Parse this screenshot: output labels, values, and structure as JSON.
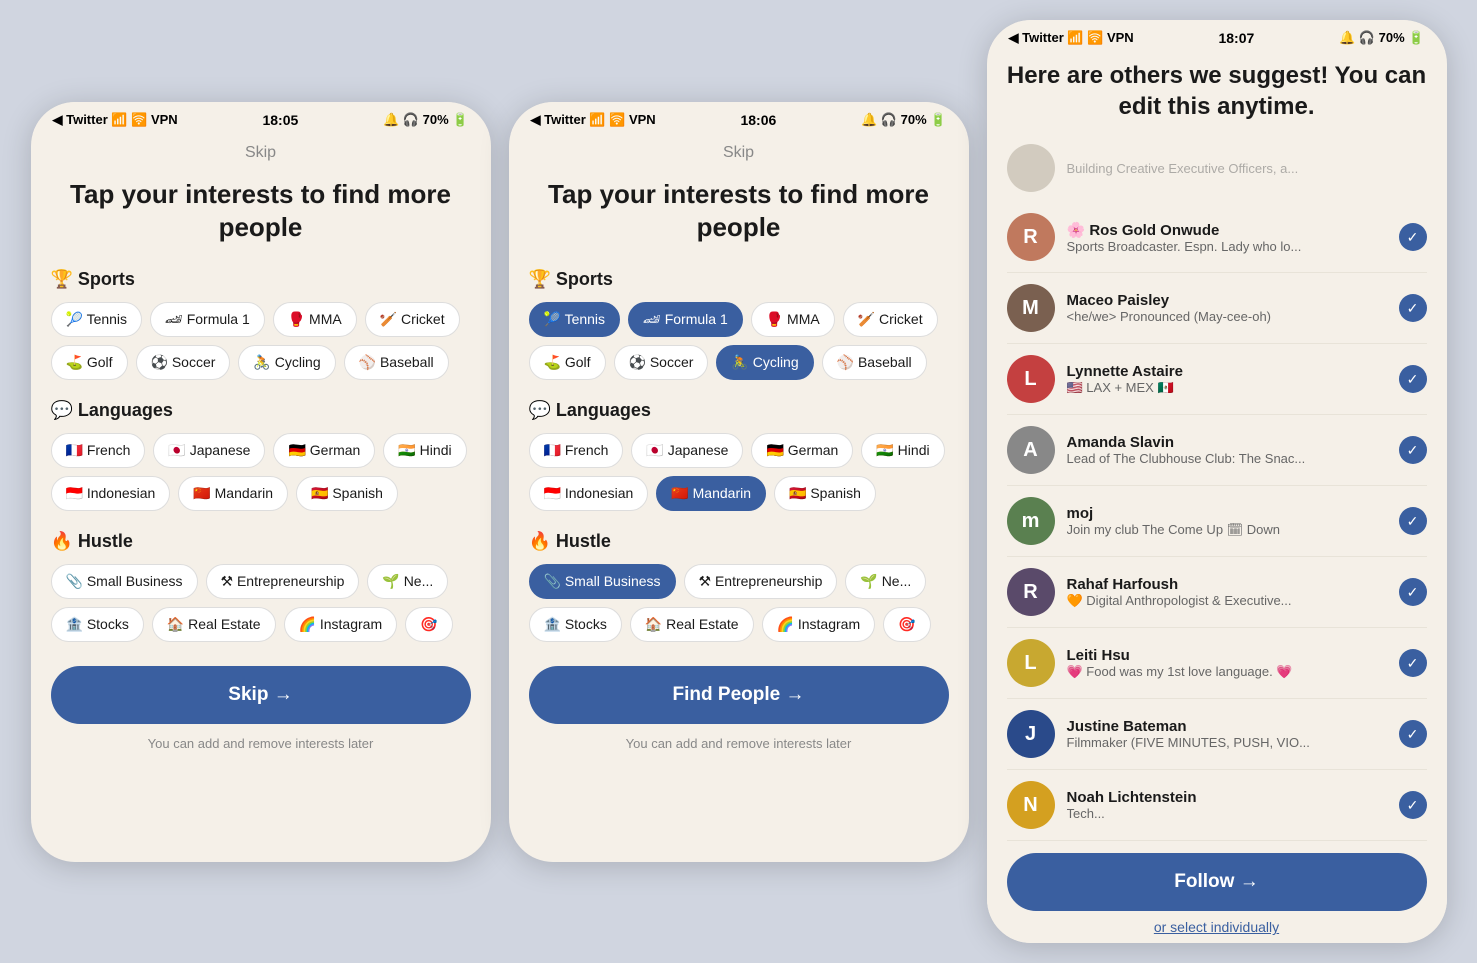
{
  "screens": [
    {
      "id": "screen1",
      "statusBar": {
        "left": "◀ Twitter  📶 🛜 VPN",
        "center": "18:05",
        "right": "🔔 🎧 70% 🔋"
      },
      "skip": "Skip",
      "title": "Tap your interests\nto find more people",
      "categories": [
        {
          "icon": "🏆",
          "name": "Sports",
          "tags": [
            {
              "label": "🎾 Tennis",
              "selected": false
            },
            {
              "label": "🏎 Formula 1",
              "selected": false
            },
            {
              "label": "🥊 MMA",
              "selected": false
            },
            {
              "label": "🏏 Cricket",
              "selected": false
            },
            {
              "label": "⛳ Golf",
              "selected": false
            },
            {
              "label": "⚽ Soccer",
              "selected": false
            },
            {
              "label": "🚴 Cycling",
              "selected": false
            },
            {
              "label": "⚾ Baseball",
              "selected": false
            }
          ]
        },
        {
          "icon": "💬",
          "name": "Languages",
          "tags": [
            {
              "label": "🇫🇷 French",
              "selected": false
            },
            {
              "label": "🇯🇵 Japanese",
              "selected": false
            },
            {
              "label": "🇩🇪 German",
              "selected": false
            },
            {
              "label": "🇮🇳 Hindi",
              "selected": false
            },
            {
              "label": "🇮🇩 Indonesian",
              "selected": false
            },
            {
              "label": "🇨🇳 Mandarin",
              "selected": false
            },
            {
              "label": "🇪🇸 Spanish",
              "selected": false
            }
          ]
        },
        {
          "icon": "🔥",
          "name": "Hustle",
          "tags": [
            {
              "label": "📎 Small Business",
              "selected": false
            },
            {
              "label": "⚒ Entrepreneurship",
              "selected": false
            },
            {
              "label": "🌱 Ne...",
              "selected": false
            },
            {
              "label": "🏦 Stocks",
              "selected": false
            },
            {
              "label": "🏠 Real Estate",
              "selected": false
            },
            {
              "label": "🌈 Instagram",
              "selected": false
            }
          ]
        }
      ],
      "actionBtn": "Skip →",
      "hint": "You can add and remove interests later"
    },
    {
      "id": "screen2",
      "statusBar": {
        "left": "◀ Twitter  📶 🛜 VPN",
        "center": "18:06",
        "right": "🔔 🎧 70% 🔋"
      },
      "skip": "Skip",
      "title": "Tap your interests\nto find more people",
      "categories": [
        {
          "icon": "🏆",
          "name": "Sports",
          "tags": [
            {
              "label": "🎾 Tennis",
              "selected": true
            },
            {
              "label": "🏎 Formula 1",
              "selected": true
            },
            {
              "label": "🥊 MMA",
              "selected": false
            },
            {
              "label": "🏏 Cricket",
              "selected": false
            },
            {
              "label": "⛳ Golf",
              "selected": false
            },
            {
              "label": "⚽ Soccer",
              "selected": false
            },
            {
              "label": "🚴 Cycling",
              "selected": true
            },
            {
              "label": "⚾ Baseball",
              "selected": false
            }
          ]
        },
        {
          "icon": "💬",
          "name": "Languages",
          "tags": [
            {
              "label": "🇫🇷 French",
              "selected": false
            },
            {
              "label": "🇯🇵 Japanese",
              "selected": false
            },
            {
              "label": "🇩🇪 German",
              "selected": false
            },
            {
              "label": "🇮🇳 Hindi",
              "selected": false
            },
            {
              "label": "🇮🇩 Indonesian",
              "selected": false
            },
            {
              "label": "🇨🇳 Mandarin",
              "selected": true
            },
            {
              "label": "🇪🇸 Spanish",
              "selected": false
            }
          ]
        },
        {
          "icon": "🔥",
          "name": "Hustle",
          "tags": [
            {
              "label": "📎 Small Business",
              "selected": true
            },
            {
              "label": "⚒ Entrepreneurship",
              "selected": false
            },
            {
              "label": "🌱 Ne...",
              "selected": false
            },
            {
              "label": "🏦 Stocks",
              "selected": false
            },
            {
              "label": "🏠 Real Estate",
              "selected": false
            },
            {
              "label": "🌈 Instagram",
              "selected": false
            }
          ]
        }
      ],
      "actionBtn": "Find People →",
      "hint": "You can add and remove interests later"
    },
    {
      "id": "screen3",
      "statusBar": {
        "left": "◀ Twitter  📶 🛜 VPN",
        "center": "18:07",
        "right": "🔔 🎧 70% 🔋"
      },
      "title": "Here are others we suggest!\nYou can edit this anytime.",
      "truncatedText": "Building Creative Executive Officers, a...",
      "people": [
        {
          "name": "Ros Gold Onwude",
          "namePrefix": "🌸",
          "bio": "Sports Broadcaster. Espn. Lady who lo...",
          "avatarColor": "#c0795e",
          "avatarText": "R",
          "checked": true
        },
        {
          "name": "Maceo Paisley",
          "namePrefix": "",
          "bio": "<he/we> Pronounced (May-cee-oh)",
          "avatarColor": "#7a6050",
          "avatarText": "M",
          "checked": true
        },
        {
          "name": "Lynnette Astaire",
          "namePrefix": "",
          "bio": "🇺🇸 LAX + MEX 🇲🇽",
          "avatarColor": "#c44040",
          "avatarText": "L",
          "checked": true
        },
        {
          "name": "Amanda Slavin",
          "namePrefix": "",
          "bio": "Lead of The Clubhouse Club: The Snac...",
          "avatarColor": "#888",
          "avatarText": "A",
          "checked": true
        },
        {
          "name": "moj",
          "namePrefix": "",
          "bio": "Join my club The Come Up 🗓 Down",
          "avatarColor": "#5a8050",
          "avatarText": "m",
          "checked": true
        },
        {
          "name": "Rahaf Harfoush",
          "namePrefix": "",
          "bio": "🧡 Digital Anthropologist & Executive...",
          "avatarColor": "#5a4a6a",
          "avatarText": "R",
          "checked": true
        },
        {
          "name": "Leiti Hsu",
          "namePrefix": "",
          "bio": "💗 Food was my 1st love language. 💗",
          "avatarColor": "#c8a830",
          "avatarText": "L",
          "checked": true
        },
        {
          "name": "Justine Bateman",
          "namePrefix": "",
          "bio": "Filmmaker (FIVE MINUTES, PUSH, VIO...",
          "avatarColor": "#2a4a8a",
          "avatarText": "J",
          "checked": true
        },
        {
          "name": "Noah Lichtenstein",
          "namePrefix": "",
          "bio": "Tech...",
          "avatarColor": "#d4a020",
          "avatarText": "N",
          "checked": true
        }
      ],
      "actionBtn": "Follow →",
      "selectLink": "or select individually"
    }
  ]
}
